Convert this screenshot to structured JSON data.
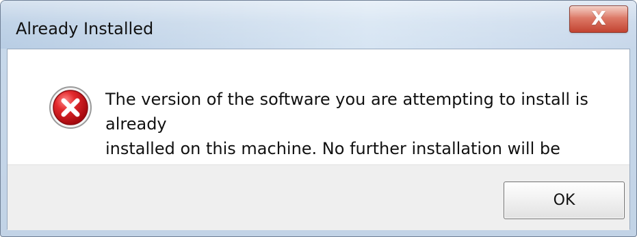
{
  "window": {
    "title": "Already Installed",
    "close_glyph": "X"
  },
  "dialog": {
    "message": "The version of the software you are attempting to install is already\ninstalled on this machine.  No further installation will be done",
    "ok_label": "OK",
    "icon": "error-icon"
  },
  "colors": {
    "error_red": "#d91f26",
    "close_red": "#d96a56",
    "title_blue": "#c7d8ea"
  }
}
